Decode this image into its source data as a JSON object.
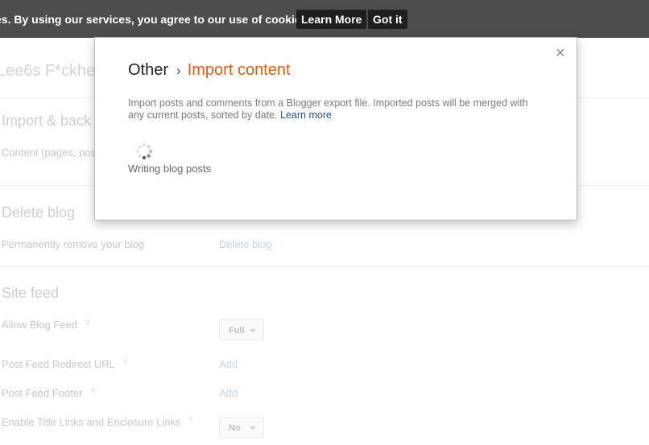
{
  "cookie_bar": {
    "text": "es. By using our services, you agree to our use of cookies.",
    "learn_more": "Learn More",
    "got_it": "Got it"
  },
  "background": {
    "blog_title": "Lee6s F*ckhe",
    "import_section": {
      "title": "Import & back",
      "content_label": "Content (pages, pos"
    },
    "delete_section": {
      "title": "Delete blog",
      "label": "Permanently remove your blog",
      "link": "Delete blog"
    },
    "site_feed": {
      "title": "Site feed",
      "allow_blog_feed": {
        "label": "Allow Blog Feed",
        "help": "?",
        "value": "Full"
      },
      "post_feed_redirect": {
        "label": "Post Feed Redirect URL",
        "help": "?",
        "link": "Add"
      },
      "post_feed_footer": {
        "label": "Post Feed Footer",
        "help": "?",
        "link": "Add"
      },
      "title_links": {
        "label": "Enable Title Links and Enclosure Links",
        "help": "?",
        "value": "No"
      }
    }
  },
  "modal": {
    "close": "×",
    "breadcrumb_parent": "Other",
    "breadcrumb_separator": "›",
    "breadcrumb_current": "Import content",
    "description": "Import posts and comments from a Blogger export file. Imported posts will be merged with any current posts, sorted by date.",
    "learn_more": "Learn more",
    "status": "Writing blog posts",
    "accent_color": "#dd5d12",
    "link_color": "#2651a3"
  }
}
